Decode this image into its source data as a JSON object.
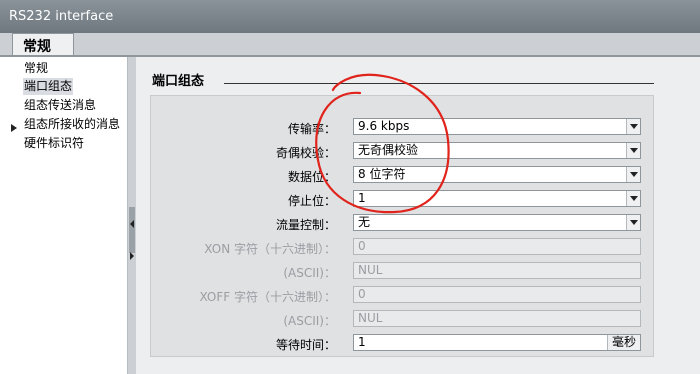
{
  "window": {
    "title": "RS232 interface"
  },
  "tab": {
    "label": "常规"
  },
  "sidebar": {
    "items": [
      {
        "label": "常规"
      },
      {
        "label": "端口组态"
      },
      {
        "label": "组态传送消息"
      },
      {
        "label": "组态所接收的消息"
      },
      {
        "label": "硬件标识符"
      }
    ]
  },
  "section": {
    "title": "端口组态"
  },
  "form": {
    "baud_rate": {
      "label": "传输率：",
      "value": "9.6 kbps"
    },
    "parity": {
      "label": "奇偶校验：",
      "value": "无奇偶校验"
    },
    "data_bits": {
      "label": "数据位：",
      "value": "8 位字符"
    },
    "stop_bits": {
      "label": "停止位：",
      "value": "1"
    },
    "flow_control": {
      "label": "流量控制：",
      "value": "无"
    },
    "xon_hex": {
      "label": "XON 字符（十六进制）：",
      "value": "0"
    },
    "xon_ascii": {
      "label": "(ASCII)：",
      "value": "NUL"
    },
    "xoff_hex": {
      "label": "XOFF 字符（十六进制）：",
      "value": "0"
    },
    "xoff_ascii": {
      "label": "(ASCII)：",
      "value": "NUL"
    },
    "wait_time": {
      "label": "等待时间：",
      "value": "1",
      "unit": "毫秒"
    }
  },
  "colors": {
    "annotation_circle": "#e0231b"
  }
}
